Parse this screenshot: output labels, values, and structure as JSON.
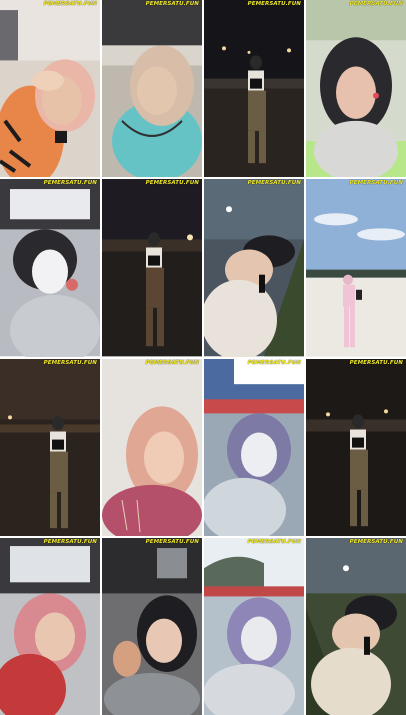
{
  "grid": {
    "rows": 4,
    "cols": 4,
    "watermark": "PEMERSATU.FUN"
  },
  "tiles": [
    {
      "scene": "car-selfie-peach-hijab",
      "bg": "#d9cfc6",
      "accent": "#e98a4a"
    },
    {
      "scene": "car-selfie-beige-hijab",
      "bg": "#c7c2bb",
      "accent": "#6cc3c8"
    },
    {
      "scene": "night-street-standing",
      "bg": "#1b1a1d",
      "accent": "#6b5a44"
    },
    {
      "scene": "black-hijab-selfie",
      "bg": "#d8ddd2",
      "accent": "#2a2a2e"
    },
    {
      "scene": "car-selfie-mask",
      "bg": "#c8ccd2",
      "accent": "#eef0f2"
    },
    {
      "scene": "night-field-standing",
      "bg": "#24222a",
      "accent": "#5a4632"
    },
    {
      "scene": "car-selfie-tilted",
      "bg": "#53606a",
      "accent": "#d8c8b8"
    },
    {
      "scene": "beach-pink-outfit",
      "bg": "#8fb1d8",
      "accent": "#f0c8d6"
    },
    {
      "scene": "night-plaza-standing",
      "bg": "#2b2520",
      "accent": "#6b5a44"
    },
    {
      "scene": "pink-hijab-indoor",
      "bg": "#e6e3df",
      "accent": "#c86a80"
    },
    {
      "scene": "car-selfie-mauve-hijab",
      "bg": "#9fb0bf",
      "accent": "#7d7aa6"
    },
    {
      "scene": "night-plaza-standing-2",
      "bg": "#201c1a",
      "accent": "#6b5a44"
    },
    {
      "scene": "car-selfie-pink-hijab",
      "bg": "#c0c2c6",
      "accent": "#d98a90"
    },
    {
      "scene": "car-selfie-black-hijab",
      "bg": "#7a7a7c",
      "accent": "#1e1e22"
    },
    {
      "scene": "car-selfie-lavender-hijab",
      "bg": "#b7c3cd",
      "accent": "#8f86b8"
    },
    {
      "scene": "car-selfie-night-tilted",
      "bg": "#4a5a3c",
      "accent": "#e0d4c4"
    }
  ]
}
